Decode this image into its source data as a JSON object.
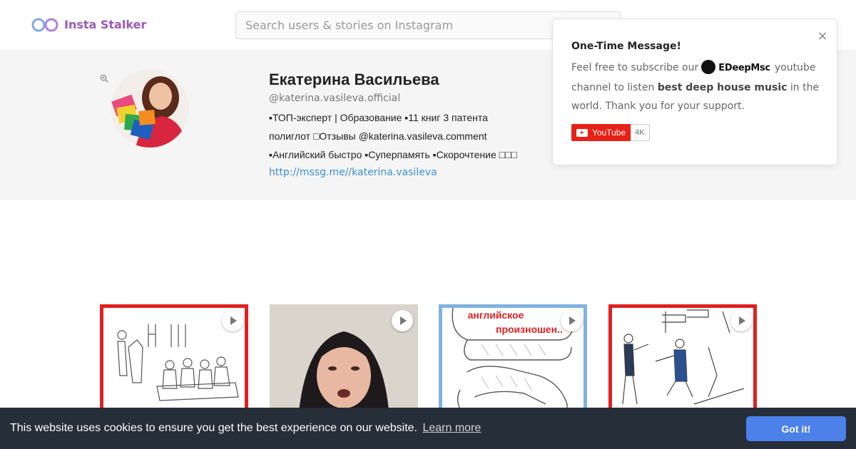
{
  "header": {
    "app_name": "Insta Stalker",
    "search_placeholder": "Search users & stories on Instagram"
  },
  "profile": {
    "name": "Екатерина Васильева",
    "handle": "@katerina.vasileva.official",
    "bio_lines": [
      "▪ТОП-эксперт | Образование ▪11 книг 3 патента",
      "полиглот □Отзывы @katerina.vasileva.comment",
      "▪Английский быстро ▪Суперпамять ▪Скорочтение □□□"
    ],
    "link": "http://mssg.me//katerina.vasileva"
  },
  "popup": {
    "title": "One-Time Message!",
    "text_before": "Feel free to subscribe our",
    "brand": "EDeepMsc",
    "text_after": "youtube",
    "line2_a": "channel to listen",
    "line2_bold": "best deep house music",
    "line2_b": "in the",
    "line3": "world. Thank you for your support.",
    "youtube_label": "YouTube",
    "youtube_count": "4K",
    "close_glyph": "×"
  },
  "posts": [
    {
      "id": 1,
      "caption_overlay": "",
      "border_color": "#e02020"
    },
    {
      "id": 2,
      "caption_overlay": "",
      "border_color": ""
    },
    {
      "id": 3,
      "caption_overlay": "английское произношен..",
      "border_color": "#7fb2e0"
    },
    {
      "id": 4,
      "caption_overlay": "",
      "border_color": "#e02020"
    }
  ],
  "post3_overlay_line1": "английское",
  "post3_overlay_line2": "произношен..",
  "cookie": {
    "message": "This website uses cookies to ensure you get the best experience on our website.",
    "learn_more": "Learn more",
    "button": "Got it!"
  },
  "colors": {
    "brand_purple": "#9b59b6",
    "link_blue": "#3b8fd6",
    "cookie_bg": "#252e39",
    "cookie_button": "#4b81e8",
    "youtube_red": "#e62117"
  }
}
